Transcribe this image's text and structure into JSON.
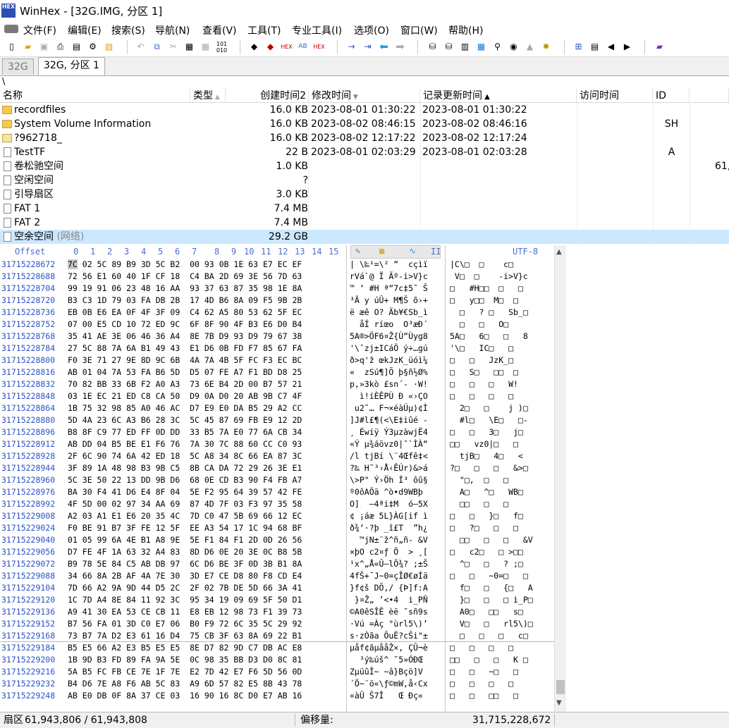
{
  "window": {
    "title": "WinHex - [32G.IMG, 分区 1]",
    "app_icon_text": "HEX"
  },
  "menu": [
    "文件(F)",
    "编辑(E)",
    "搜索(S)",
    "导航(N)",
    "查看(V)",
    "工具(T)",
    "专业工具(I)",
    "选项(O)",
    "窗口(W)",
    "帮助(H)"
  ],
  "tabs": [
    "32G",
    "32G, 分区 1"
  ],
  "path": "\\",
  "columns": {
    "name": "名称",
    "type": "类型",
    "created": "创建时间2",
    "modified": "修改时间",
    "record": "记录更新时间",
    "accessed": "访问时间",
    "id": "ID"
  },
  "files": [
    {
      "name": "recordfiles",
      "size": "16.0 KB",
      "modified": "2023-08-01  01:30:22",
      "record": "2023-08-01  01:30:22",
      "id": "",
      "extra": ""
    },
    {
      "name": "System Volume Information",
      "size": "16.0 KB",
      "modified": "2023-08-02  08:46:15",
      "record": "2023-08-02  08:46:16",
      "id": "SH",
      "extra": ""
    },
    {
      "name": "?962718_",
      "size": "16.0 KB",
      "modified": "2023-08-02  12:17:22",
      "record": "2023-08-02  12:17:24",
      "id": "",
      "extra": ""
    },
    {
      "name": "TestTF",
      "size": "22 B",
      "modified": "2023-08-01  02:03:29",
      "record": "2023-08-01  02:03:28",
      "id": "A",
      "extra": ""
    },
    {
      "name": "卷松驰空间",
      "size": "1.0 KB",
      "modified": "",
      "record": "",
      "id": "",
      "extra": "61,"
    },
    {
      "name": "空闲空间",
      "size": "?",
      "modified": "",
      "record": "",
      "id": "",
      "extra": ""
    },
    {
      "name": "引导扇区",
      "size": "3.0 KB",
      "modified": "",
      "record": "",
      "id": "",
      "extra": ""
    },
    {
      "name": "FAT 1",
      "size": "7.4 MB",
      "modified": "",
      "record": "",
      "id": "",
      "extra": ""
    },
    {
      "name": "FAT 2",
      "size": "7.4 MB",
      "modified": "",
      "record": "",
      "id": "",
      "extra": ""
    },
    {
      "name": "空余空间",
      "name_note": "(网络)",
      "size": "29.2 GB",
      "modified": "",
      "record": "",
      "id": "",
      "extra": ""
    }
  ],
  "hex_header": {
    "offset": "Offset",
    "columns": [
      "0",
      "1",
      "2",
      "3",
      "4",
      "5",
      "6",
      "7",
      "8",
      "9",
      "10",
      "11",
      "12",
      "13",
      "14",
      "15"
    ],
    "ansi_suffix": "II",
    "utf_label": "UTF-8"
  },
  "hex_rows": [
    {
      "offset": "31715228672",
      "hex": "7C 02 5C 89 B9 3D 5C B2  00 93 0B 1E 63 E7 EC EF",
      "text": "| \\‰¹=\\² “  cçìï",
      "utf": "|C\\□  □    c□"
    },
    {
      "offset": "31715228688",
      "hex": "72 56 E1 60 40 1F CF 18  C4 BA 2D 69 3E 56 7D 63",
      "text": "rVá`@ Ï Äº-i>V}c",
      "utf": " V□  □    -i>V}c"
    },
    {
      "offset": "31715228704",
      "hex": "99 19 91 06 23 48 16 AA  93 37 63 87 35 98 1E 8A",
      "text": "™ ‘ #H ª“7c‡5˜ Š",
      "utf": "□   #H□□  □   □"
    },
    {
      "offset": "31715228720",
      "hex": "B3 C3 1D 79 03 FA DB 2B  17 4D B6 8A 09 F5 9B 2B",
      "text": "³Ã y úÛ+ M¶Š õ›+",
      "utf": "□   y□□  M□  □"
    },
    {
      "offset": "31715228736",
      "hex": "EB 0B E6 EA 0F 4F 3F 09  C4 62 A5 80 53 62 5F EC",
      "text": "ë æê O? Äb¥€Sb_ì",
      "utf": "  □   ? □   Sb_□"
    },
    {
      "offset": "31715228752",
      "hex": "07 00 E5 CD 10 72 ED 9C  6F 8F 90 4F B3 E6 D0 B4",
      "text": "  åÍ ríœo  O³æÐ´",
      "utf": "  □   □   O□"
    },
    {
      "offset": "31715228768",
      "hex": "35 41 AE 3E 06 46 36 A4  8E 7B D9 93 D9 79 67 38",
      "text": "5A®>ÖF6¤Ž{Ù“Ùyg8",
      "utf": "5A□   6□   □   8"
    },
    {
      "offset": "31715228784",
      "hex": "27 5C 88 7A 6A B1 49 43  E1 D6 0B FD F7 85 67 FA",
      "text": "'\\ˆzj±ICáÖ ý÷…gú",
      "utf": "'\\□   IC□   □"
    },
    {
      "offset": "31715228800",
      "hex": "F0 3E 71 27 9E 8D 9C 6B  4A 7A 4B 5F FC F3 EC BC",
      "text": "ð>q'ž œkJzK_üóì¼",
      "utf": "□   □   JzK_□"
    },
    {
      "offset": "31715228816",
      "hex": "AB 01 04 7A 53 FA B6 5D  D5 07 FE A7 F1 BD D8 25",
      "text": "«  zSú¶]Õ þ§ñ½Ø%",
      "utf": "□   S□   □□  □"
    },
    {
      "offset": "31715228832",
      "hex": "70 82 BB 33 6B F2 A0 A3  73 6E B4 2D 00 B7 57 21",
      "text": "p‚»3kò £sn´- ·W!",
      "utf": "□   □   □   W!"
    },
    {
      "offset": "31715228848",
      "hex": "03 1E EC 21 ED C8 CA 50  D9 0A D0 20 AB 9B C7 4F",
      "text": "  ì!íÈÊPÙ Ð «›ÇO",
      "utf": "□   □   □   □"
    },
    {
      "offset": "31715228864",
      "hex": "1B 75 32 98 85 A0 46 AC  D7 E9 E0 DA B5 29 A2 CC",
      "text": " u2˜… F¬×éàÚµ)¢Ì",
      "utf": "  2□   □    j )□"
    },
    {
      "offset": "31715228880",
      "hex": "5D 4A 23 6C A3 B6 28 3C  5C 45 87 69 FB E9 12 2D",
      "text": "]J#l£¶(<\\E‡iûé -",
      "utf": "  #l□   \\E□   □-"
    },
    {
      "offset": "31715228896",
      "hex": "B8 8F C9 77 ED FF 0D DD  33 B5 7A E0 77 6A CB 34",
      "text": "¸ Éwíÿ Ý3µzàwjË4",
      "utf": "□   □   3□   j□"
    },
    {
      "offset": "31715228912",
      "hex": "AB DD 04 B5 BE E1 F6 76  7A 30 7C 88 60 CC C0 93",
      "text": "«Ý µ¾áövz0|ˆ`ÌÀ“",
      "utf": "□□   vz0|□   □"
    },
    {
      "offset": "31715228928",
      "hex": "2F 6C 90 74 6A 42 ED 18  5C A8 34 8C 66 EA 87 3C",
      "text": "/l tjBí \\¨4Œfê‡<",
      "utf": "  tjB□   4□   <"
    },
    {
      "offset": "31715228944",
      "hex": "3F 89 1A 48 98 B3 9B C5  8B CA DA 72 29 26 3E E1",
      "text": "?‰ H˜³›Å‹ÊÚr)&>á",
      "utf": "?□   □   □   &>□"
    },
    {
      "offset": "31715228960",
      "hex": "5C 3E 50 22 13 DD 9B D6  68 0E CD B3 90 F4 FB A7",
      "text": "\\>P\" Ý›Öh Í³ ôû§",
      "utf": "  \"□,  □   □"
    },
    {
      "offset": "31715228976",
      "hex": "BA 30 F4 41 D6 E4 8F 04  5E F2 95 64 39 57 42 FE",
      "text": "º0ôAÖä ^ò•d9WBþ",
      "utf": "  A□   ^□   WB□"
    },
    {
      "offset": "31715228992",
      "hex": "4F 5D 00 02 97 34 AA 69  87 4D 7F 03 F3 97 35 58",
      "text": "O]  —4ªi‡M  ó—5X",
      "utf": "  □□   □   □"
    },
    {
      "offset": "31715229008",
      "hex": "A2 03 A1 E1 E6 20 35 4C  7D C0 47 5B 69 66 12 EC",
      "text": "¢ ¡áæ 5L}ÀG[if ì",
      "utf": "□   □   }□   f□"
    },
    {
      "offset": "31715229024",
      "hex": "F0 BE 91 B7 3F FE 12 5F  EE A3 54 17 1C 94 68 BF",
      "text": "ð¾‘·?þ _î£T  ”h¿",
      "utf": "□   ?□   □   □"
    },
    {
      "offset": "31715229040",
      "hex": "01 05 99 6A 4E B1 A8 9E  5E F1 84 F1 2D 0D 26 56",
      "text": "  ™jN±¨ž^ñ„ñ- &V",
      "utf": "  □□   □   □   &V"
    },
    {
      "offset": "31715229056",
      "hex": "D7 FE 4F 1A 63 32 A4 83  8D D6 0E 20 3E 0C B8 5B",
      "text": "×þO c2¤ƒ Ö  > ¸[",
      "utf": "□   c2□   □ >□□"
    },
    {
      "offset": "31715229072",
      "hex": "B9 78 5E 84 C5 AB DB 97  6C D6 BE 3F 0D 3B B1 8A",
      "text": "¹x^„Å«Û—lÖ¾? ;±Š",
      "utf": "  ^□   □   ? ;□"
    },
    {
      "offset": "31715229088",
      "hex": "34 66 8A 2B AF 4A 7E 30  3D E7 CE D8 80 F8 CD E4",
      "text": "4fŠ+¯J~0=çÎØ€øÍä",
      "utf": "□   □   ~0=□   □"
    },
    {
      "offset": "31715229104",
      "hex": "7D 66 A2 9A 9D 44 D5 2C  2F 02 7B DE 5D 66 3A 41",
      "text": "}f¢š DÕ,/ {Þ]f:A",
      "utf": "  f□   □   {□   A"
    },
    {
      "offset": "31715229120",
      "hex": "1C 7D A4 8E 84 11 92 3C  95 34 19 09 69 5F 50 D1",
      "text": " }¤Ž„ ’<•4  i_PÑ",
      "utf": "  }□   □   □ i_P□"
    },
    {
      "offset": "31715229136",
      "hex": "A9 41 30 EA 53 CE CB 11  E8 EB 12 98 73 F1 39 73",
      "text": "©A0êSÎË èë ˜sñ9s",
      "utf": "  A0□   □□   s□"
    },
    {
      "offset": "31715229152",
      "hex": "B7 56 FA 01 3D C0 E7 06  B0 F9 72 6C 35 5C 29 92",
      "text": "·Vú =Àç °ùrl5\\)’",
      "utf": "  V□   □   rl5\\)□"
    },
    {
      "offset": "31715229168",
      "hex": "73 B7 7A D2 E3 61 16 D4  75 CB 3F 63 8A 69 22 B1",
      "text": "s·zÒãa ÔuË?cŠi\"±",
      "utf": "  □   □   □   c□"
    },
    {
      "offset": "31715229184",
      "hex": "B5 E5 66 A2 E3 B5 E5 E5  8E D7 82 9D C7 DB AC E8",
      "text": "µåf¢ãµååŽ×‚ ÇÛ¬è",
      "utf": "□   □   □   □"
    },
    {
      "offset": "31715229200",
      "hex": "1B 9D B3 FD 89 FA 9A 5E  0C 98 35 BB D3 D0 8C 81",
      "text": "  ³ý‰úš^ ˜5»ÓÐŒ ",
      "utf": "□□   □   □   K □"
    },
    {
      "offset": "31715229216",
      "hex": "5A B5 FC FB CE 7E 1F 7E  E2 7D 42 E7 F6 5D 56 0D",
      "text": "ZµüûÎ~ ~â}Bçö]V ",
      "utf": "□   □   ~□   □"
    },
    {
      "offset": "31715229232",
      "hex": "B4 D6 7E A8 F6 AB 5C 83  A9 6D 57 82 E5 8B 43 78",
      "text": "´Ö~¨ö«\\ƒ©mW‚å‹Cx",
      "utf": "□   □   □   □"
    },
    {
      "offset": "31715229248",
      "hex": "AB E0 DB 0F 8A 37 CE 03  16 90 16 8C D0 E7 AB 16",
      "text": "«àÛ Š7Î   Œ Ðç« ",
      "utf": "□   □   □□   □"
    }
  ],
  "status": {
    "sector_label": "扇区",
    "sector_value": "61,943,806 / 61,943,808",
    "offset_label": "偏移量:",
    "offset_value": "31,715,228,672"
  }
}
